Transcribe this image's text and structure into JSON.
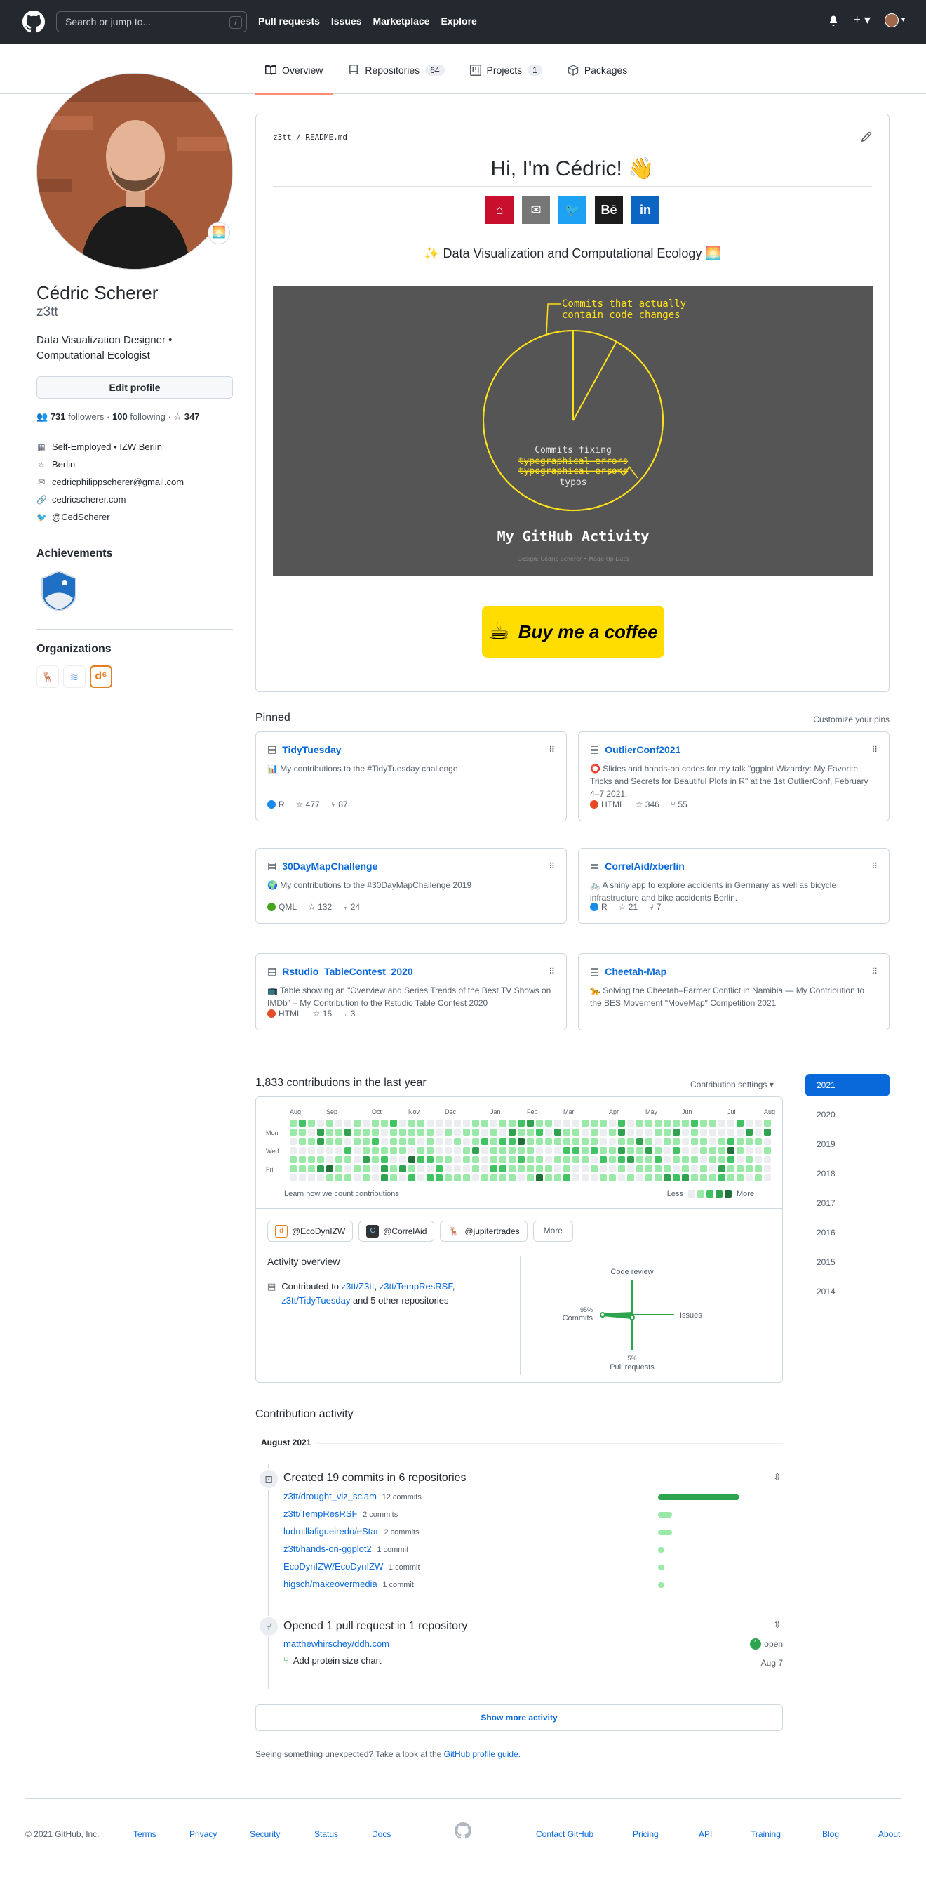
{
  "header": {
    "search_placeholder": "Search or jump to...",
    "search_hint": "/",
    "nav": [
      "Pull requests",
      "Issues",
      "Marketplace",
      "Explore"
    ]
  },
  "tabs": [
    {
      "label": "Overview",
      "count": ""
    },
    {
      "label": "Repositories",
      "count": "64"
    },
    {
      "label": "Projects",
      "count": "1"
    },
    {
      "label": "Packages",
      "count": ""
    }
  ],
  "profile": {
    "name": "Cédric Scherer",
    "login": "z3tt",
    "bio": "Data Visualization Designer • Computational Ecologist",
    "edit_label": "Edit profile",
    "followers": "731",
    "followers_label": "followers",
    "following": "100",
    "following_label": "following",
    "stars": "347",
    "company": "Self-Employed • IZW Berlin",
    "location": "Berlin",
    "email": "cedricphilippscherer@gmail.com",
    "website": "cedricscherer.com",
    "twitter": "@CedScherer",
    "achievements_title": "Achievements",
    "organizations_title": "Organizations"
  },
  "readme": {
    "path_user": "z3tt",
    "path_file": "README.md",
    "title": "Hi, I'm Cédric! 👋",
    "tagline": "Data Visualization and Computational Ecology",
    "coffee_label": "Buy me a coffee"
  },
  "chart_data": {
    "type": "pie",
    "title": "My GitHub Activity",
    "caption": "Design: Cédric Scherer • Made-Up Data",
    "slices": [
      {
        "label": "Commits that actually contain code changes",
        "value": 8
      },
      {
        "label": "Commits fixing typographical errors typos",
        "value": 92
      }
    ],
    "annotation_top": [
      "Commits that actually",
      "contain code changes"
    ],
    "annotation_bottom": [
      "Commits fixing",
      "typographical errors",
      "typographical errors",
      "typos"
    ],
    "colors": {
      "highlight": "#ffe11a",
      "background": "#555555"
    }
  },
  "pinned": {
    "title": "Pinned",
    "customize": "Customize your pins",
    "items": [
      {
        "name": "TidyTuesday",
        "desc": "📊 My contributions to the #TidyTuesday challenge",
        "lang": "R",
        "lang_color": "#198ce7",
        "stars": "477",
        "forks": "87"
      },
      {
        "name": "OutlierConf2021",
        "desc": "⭕ Slides and hands-on codes for my talk \"ggplot Wizardry: My Favorite Tricks and Secrets for Beautiful Plots in R\" at the 1st OutlierConf, February 4–7 2021.",
        "lang": "HTML",
        "lang_color": "#e34c26",
        "stars": "346",
        "forks": "55"
      },
      {
        "name": "30DayMapChallenge",
        "desc": "🌍 My contributions to the #30DayMapChallenge 2019",
        "lang": "QML",
        "lang_color": "#44a51c",
        "stars": "132",
        "forks": "24"
      },
      {
        "name": "CorrelAid/xberlin",
        "desc": "🚲 A shiny app to explore accidents in Germany as well as bicycle infrastructure and bike accidents Berlin.",
        "lang": "R",
        "lang_color": "#198ce7",
        "stars": "21",
        "forks": "7"
      },
      {
        "name": "Rstudio_TableContest_2020",
        "desc": "📺 Table showing an \"Overview and Series Trends of the Best TV Shows on IMDb\" – My Contribution to the Rstudio Table Contest 2020",
        "lang": "HTML",
        "lang_color": "#e34c26",
        "stars": "15",
        "forks": "3"
      },
      {
        "name": "Cheetah-Map",
        "desc": "🐆 Solving the Cheetah–Farmer Conflict in Namibia — My Contribution to the BES Movement \"MoveMap\" Competition 2021",
        "lang": "",
        "lang_color": "",
        "stars": "",
        "forks": ""
      }
    ]
  },
  "contrib": {
    "title": "1,833 contributions in the last year",
    "settings": "Contribution settings ▾",
    "months": [
      "Aug",
      "Sep",
      "Oct",
      "Nov",
      "Dec",
      "Jan",
      "Feb",
      "Mar",
      "Apr",
      "May",
      "Jun",
      "Jul",
      "Aug"
    ],
    "days": [
      "Mon",
      "Wed",
      "Fri"
    ],
    "learn": "Learn how we count contributions",
    "less": "Less",
    "more": "More",
    "orgs": [
      "@EcoDynIZW",
      "@CorrelAid",
      "@jupitertrades"
    ],
    "more_btn": "More",
    "overview_title": "Activity overview",
    "contributed_prefix": "Contributed to",
    "contributed_links": [
      "z3tt/Z3tt",
      "z3tt/TempResRSF",
      "z3tt/TidyTuesday"
    ],
    "contributed_suffix": "and 5 other repositories",
    "axis": {
      "code_review": "Code review",
      "issues": "Issues",
      "pull_requests": "Pull requests",
      "commits": "Commits",
      "commits_pct": "95%",
      "pr_pct": "5%"
    },
    "years": [
      "2021",
      "2020",
      "2019",
      "2018",
      "2017",
      "2016",
      "2015",
      "2014"
    ]
  },
  "activity": {
    "title": "Contribution activity",
    "month": "August 2021",
    "commits_title": "Created 19 commits in 6 repositories",
    "commits": [
      {
        "repo": "z3tt/drought_viz_sciam",
        "count": "12 commits",
        "frac": 1.0
      },
      {
        "repo": "z3tt/TempResRSF",
        "count": "2 commits",
        "frac": 0.17
      },
      {
        "repo": "ludmillafigueiredo/eStar",
        "count": "2 commits",
        "frac": 0.17
      },
      {
        "repo": "z3tt/hands-on-ggplot2",
        "count": "1 commit",
        "frac": 0.08
      },
      {
        "repo": "EcoDynIZW/EcoDynIZW",
        "count": "1 commit",
        "frac": 0.08
      },
      {
        "repo": "higsch/makeovermedia",
        "count": "1 commit",
        "frac": 0.08
      }
    ],
    "pr_title": "Opened 1 pull request in 1 repository",
    "pr_repo": "matthewhirschey/ddh.com",
    "pr_open_count": "1",
    "pr_open": "open",
    "pr_item": "Add protein size chart",
    "pr_date": "Aug 7",
    "show_more": "Show more activity",
    "unexpected": "Seeing something unexpected? Take a look at the",
    "guide_link": "GitHub profile guide."
  },
  "footer": {
    "copyright": "© 2021 GitHub, Inc.",
    "links_left": [
      "Terms",
      "Privacy",
      "Security",
      "Status",
      "Docs"
    ],
    "links_right": [
      "Contact GitHub",
      "Pricing",
      "API",
      "Training",
      "Blog",
      "About"
    ]
  }
}
